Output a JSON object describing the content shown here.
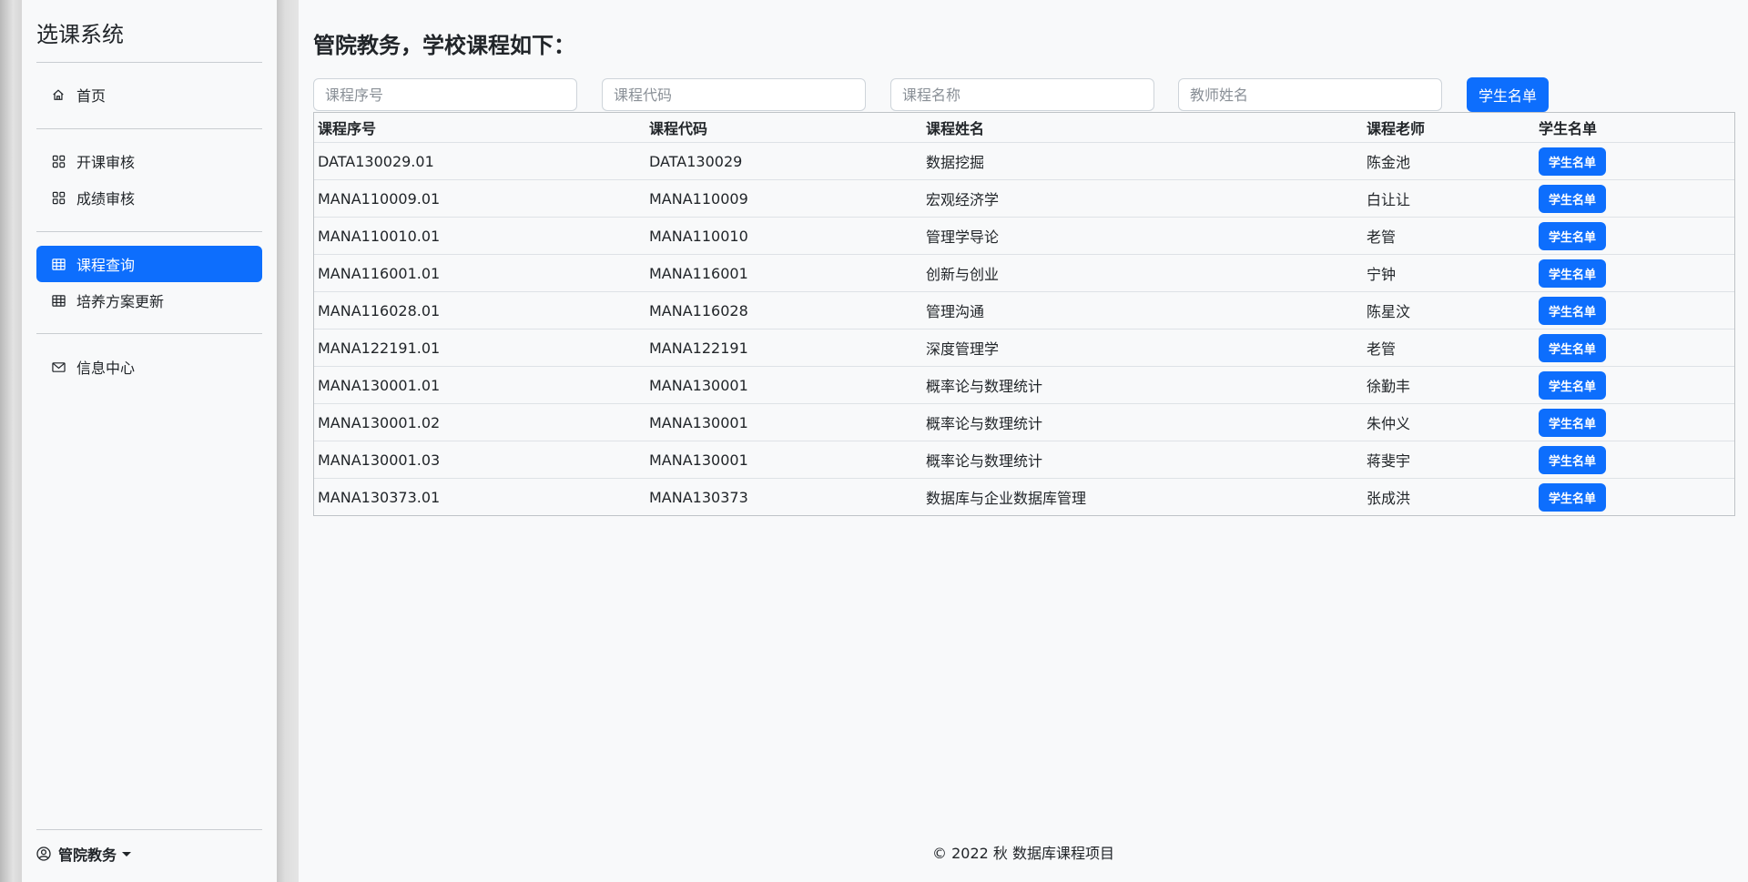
{
  "sidebar": {
    "brand": "选课系统",
    "items": [
      {
        "label": "首页",
        "icon": "house-icon"
      },
      {
        "label": "开课审核",
        "icon": "grid-icon"
      },
      {
        "label": "成绩审核",
        "icon": "grid-icon"
      },
      {
        "label": "课程查询",
        "icon": "table-icon",
        "active": true
      },
      {
        "label": "培养方案更新",
        "icon": "table-icon"
      },
      {
        "label": "信息中心",
        "icon": "envelope-icon"
      }
    ],
    "user": "管院教务"
  },
  "main": {
    "title": "管院教务，学校课程如下：",
    "search": {
      "placeholders": [
        "课程序号",
        "课程代码",
        "课程名称",
        "教师姓名"
      ],
      "button": "学生名单"
    },
    "table": {
      "headers": [
        "课程序号",
        "课程代码",
        "课程姓名",
        "课程老师",
        "学生名单"
      ],
      "button_label": "学生名单",
      "rows": [
        [
          "DATA130029.01",
          "DATA130029",
          "数据挖掘",
          "陈金池"
        ],
        [
          "MANA110009.01",
          "MANA110009",
          "宏观经济学",
          "白让让"
        ],
        [
          "MANA110010.01",
          "MANA110010",
          "管理学导论",
          "老管"
        ],
        [
          "MANA116001.01",
          "MANA116001",
          "创新与创业",
          "宁钟"
        ],
        [
          "MANA116028.01",
          "MANA116028",
          "管理沟通",
          "陈星汶"
        ],
        [
          "MANA122191.01",
          "MANA122191",
          "深度管理学",
          "老管"
        ],
        [
          "MANA130001.01",
          "MANA130001",
          "概率论与数理统计",
          "徐勤丰"
        ],
        [
          "MANA130001.02",
          "MANA130001",
          "概率论与数理统计",
          "朱仲义"
        ],
        [
          "MANA130001.03",
          "MANA130001",
          "概率论与数理统计",
          "蒋斐宇"
        ],
        [
          "MANA130373.01",
          "MANA130373",
          "数据库与企业数据库管理",
          "张成洪"
        ]
      ]
    },
    "footer": "© 2022 秋 数据库课程项目"
  },
  "colors": {
    "primary": "#0d6efd",
    "background": "#f8f9fa",
    "text": "#212529"
  }
}
